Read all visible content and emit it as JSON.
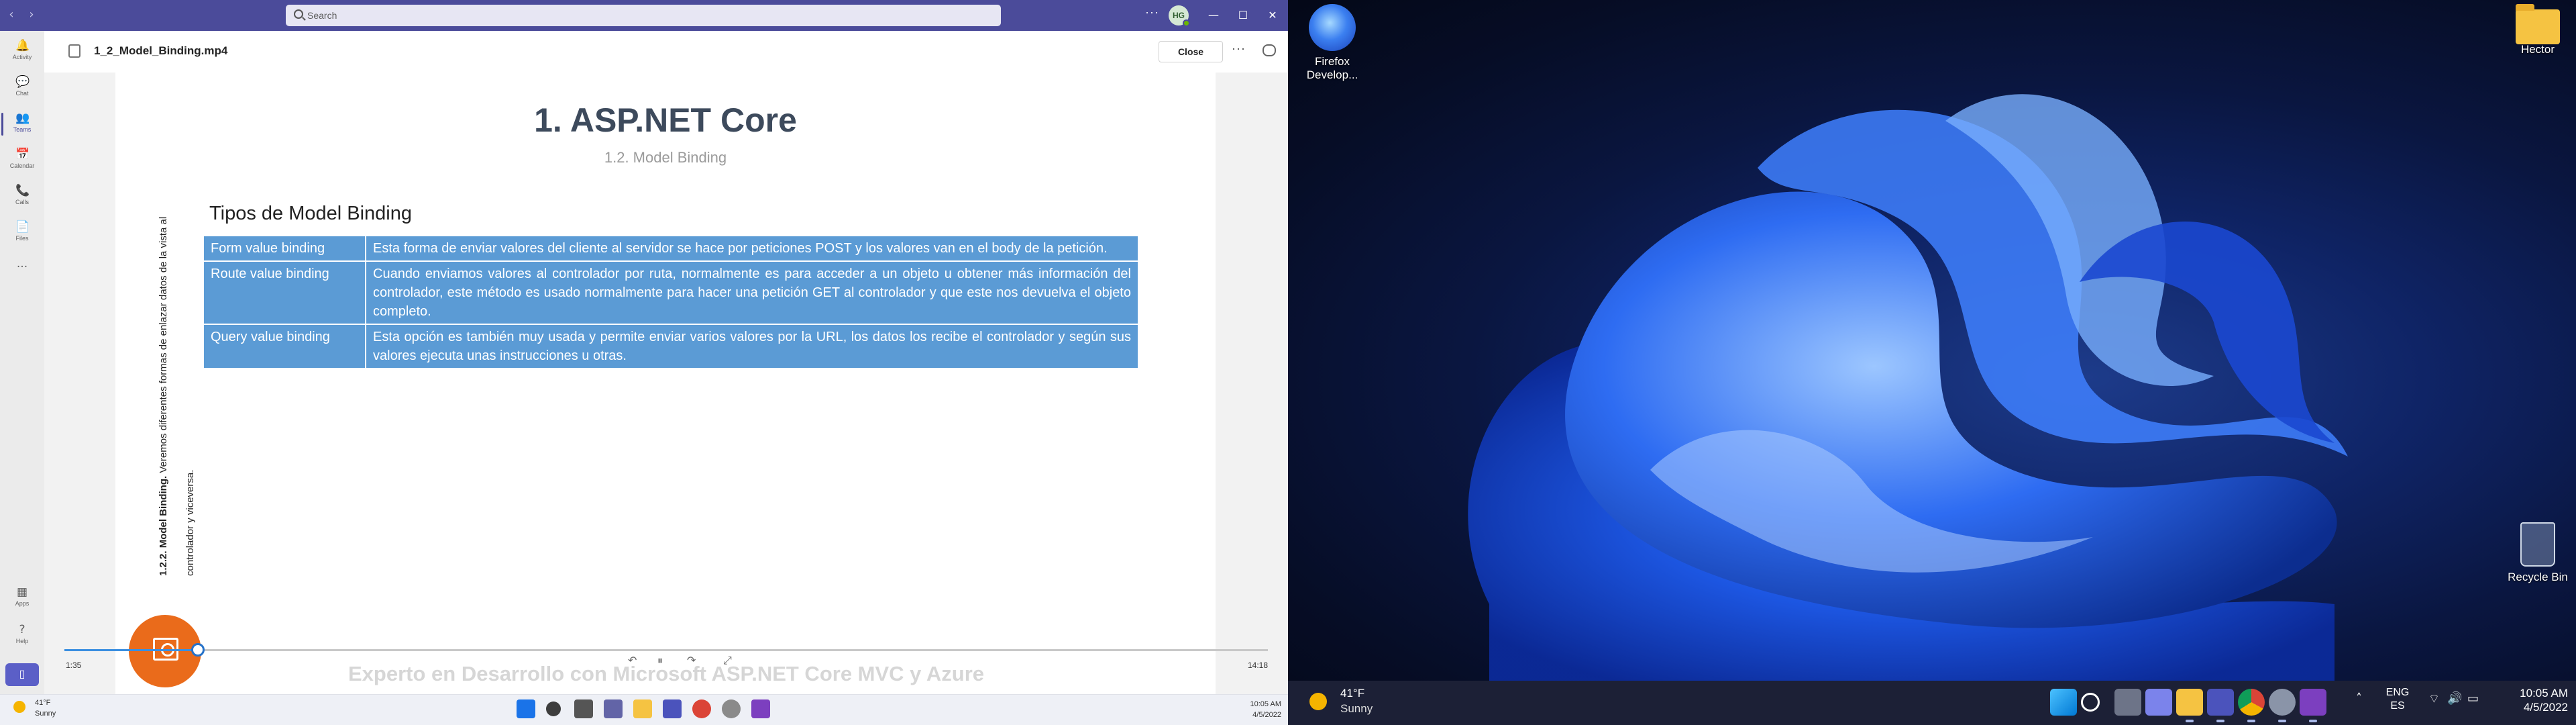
{
  "teams": {
    "search_placeholder": "Search",
    "more": "···",
    "avatar_initials": "HG",
    "window_controls": {
      "minimize": "—",
      "maximize": "☐",
      "close": "✕"
    },
    "nav": [
      {
        "label": "Activity",
        "icon": "bell-icon",
        "glyph": "🔔"
      },
      {
        "label": "Chat",
        "icon": "chat-icon",
        "glyph": "💬"
      },
      {
        "label": "Teams",
        "icon": "teams-icon",
        "glyph": "👥"
      },
      {
        "label": "Calendar",
        "icon": "calendar-icon",
        "glyph": "📅"
      },
      {
        "label": "Calls",
        "icon": "phone-icon",
        "glyph": "📞"
      },
      {
        "label": "Files",
        "icon": "file-icon",
        "glyph": "📄"
      }
    ],
    "nav_more": "···",
    "nav_bottom": [
      {
        "label": "Apps",
        "icon": "apps-icon",
        "glyph": "▦"
      },
      {
        "label": "Help",
        "icon": "help-icon",
        "glyph": "?"
      }
    ]
  },
  "viewer": {
    "file_name": "1_2_Model_Binding.mp4",
    "close_label": "Close",
    "more": "···"
  },
  "slide": {
    "title": "1. ASP.NET Core",
    "subtitle": "1.2. Model Binding",
    "vertical_note_bold": "1.2.2. Model Binding.",
    "vertical_note_rest": " Veremos diferentes formas de enlazar datos de la vista al controlador y viceversa.",
    "section_title": "Tipos de Model Binding",
    "table": [
      {
        "type": "Form value binding",
        "desc": "Esta forma de enviar valores del cliente al servidor se hace por peticiones POST y los valores van en el body de la petición."
      },
      {
        "type": "Route value binding",
        "desc": "Cuando enviamos valores al controlador por ruta, normalmente es para acceder a un objeto u obtener más información del controlador, este método es usado normalmente para hacer una petición GET al controlador y que este nos devuelva el objeto completo."
      },
      {
        "type": "Query value binding",
        "desc": "Esta opción es también muy usada y permite enviar varios valores por la URL, los datos los recibe el controlador y según sus valores ejecuta unas instrucciones u otras."
      }
    ],
    "watermark": "Experto en Desarrollo con Microsoft ASP.NET Core MVC y Azure"
  },
  "player": {
    "current_time": "1:35",
    "duration": "14:18",
    "progress_fraction": 0.111,
    "controls": {
      "rewind": "↶",
      "play_pause": "⏸",
      "forward": "↷",
      "fullscreen": "⤢"
    }
  },
  "taskbar_left": {
    "weather_temp": "41°F",
    "weather_cond": "Sunny",
    "time": "10:05 AM",
    "date": "4/5/2022"
  },
  "desktop": {
    "icons": [
      {
        "label": "Firefox Develop..."
      },
      {
        "label": "Hector"
      },
      {
        "label": "Recycle Bin"
      }
    ]
  },
  "taskbar_right": {
    "weather_temp": "41°F",
    "weather_cond": "Sunny",
    "lang_top": "ENG",
    "lang_bottom": "ES",
    "time": "10:05 AM",
    "date": "4/5/2022"
  },
  "colors": {
    "teams_purple": "#4b4b9a",
    "table_blue": "#5b9bd5",
    "fab_orange": "#ea6b1b",
    "desktop_blue": "#1d3b8a"
  }
}
